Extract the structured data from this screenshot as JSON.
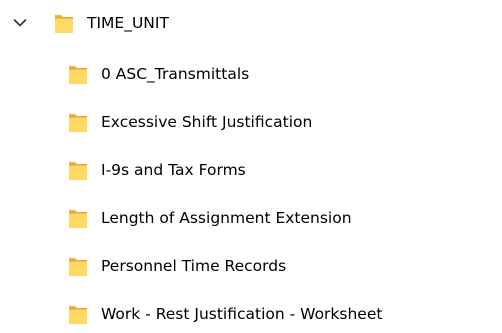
{
  "tree": {
    "root": {
      "label": "TIME_UNIT",
      "expanded": true,
      "icon": "folder-icon",
      "chevron_icon": "chevron-down-icon"
    },
    "children": [
      {
        "label": "0 ASC_Transmittals",
        "icon": "folder-icon"
      },
      {
        "label": "Excessive Shift Justification",
        "icon": "folder-icon"
      },
      {
        "label": "I-9s and Tax Forms",
        "icon": "folder-icon"
      },
      {
        "label": "Length of Assignment Extension",
        "icon": "folder-icon"
      },
      {
        "label": "Personnel Time Records",
        "icon": "folder-icon"
      },
      {
        "label": "Work - Rest Justification - Worksheet",
        "icon": "folder-icon"
      }
    ]
  },
  "colors": {
    "folder_back": "#E8B64C",
    "folder_front": "#FFD866",
    "folder_edge": "#D9A43A",
    "chevron": "#333333"
  }
}
